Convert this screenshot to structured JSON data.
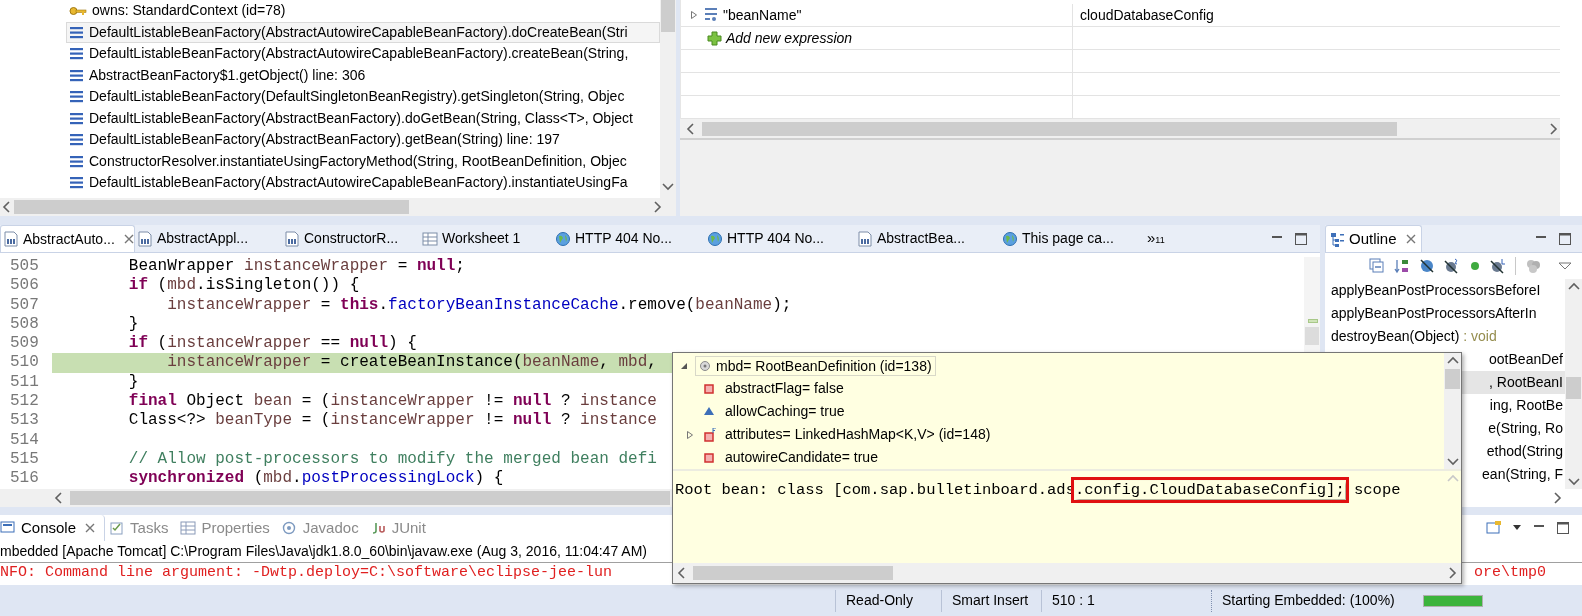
{
  "debug_stack": {
    "frames": [
      {
        "kind": "owner",
        "label": "owns: StandardContext  (id=78)",
        "selected": false
      },
      {
        "kind": "frame",
        "label": "DefaultListableBeanFactory(AbstractAutowireCapableBeanFactory).doCreateBean(Stri",
        "selected": true
      },
      {
        "kind": "frame",
        "label": "DefaultListableBeanFactory(AbstractAutowireCapableBeanFactory).createBean(String,",
        "selected": false
      },
      {
        "kind": "frame",
        "label": "AbstractBeanFactory$1.getObject() line: 306",
        "selected": false
      },
      {
        "kind": "frame",
        "label": "DefaultListableBeanFactory(DefaultSingletonBeanRegistry).getSingleton(String, Objec",
        "selected": false
      },
      {
        "kind": "frame",
        "label": "DefaultListableBeanFactory(AbstractBeanFactory).doGetBean(String, Class<T>, Object",
        "selected": false
      },
      {
        "kind": "frame",
        "label": "DefaultListableBeanFactory(AbstractBeanFactory).getBean(String) line: 197",
        "selected": false
      },
      {
        "kind": "frame",
        "label": "ConstructorResolver.instantiateUsingFactoryMethod(String, RootBeanDefinition, Objec",
        "selected": false
      },
      {
        "kind": "frame",
        "label": "DefaultListableBeanFactory(AbstractAutowireCapableBeanFactory).instantiateUsingFa",
        "selected": false
      }
    ]
  },
  "expressions": {
    "rows": [
      {
        "kind": "expression",
        "name": "\"beanName\"",
        "value": "cloudDatabaseConfig",
        "expanded": false
      },
      {
        "kind": "add",
        "name": "Add new expression"
      }
    ]
  },
  "editor": {
    "tabs": [
      {
        "label": "AbstractAuto...",
        "kind": "class",
        "selected": true
      },
      {
        "label": "AbstractAppl...",
        "kind": "class",
        "selected": false
      },
      {
        "label": "ConstructorR...",
        "kind": "class",
        "selected": false
      },
      {
        "label": "Worksheet 1",
        "kind": "sql",
        "selected": false
      },
      {
        "label": "HTTP 404 No...",
        "kind": "web",
        "selected": false
      },
      {
        "label": "HTTP 404 No...",
        "kind": "web",
        "selected": false
      },
      {
        "label": "AbstractBea...",
        "kind": "class",
        "selected": false
      },
      {
        "label": "This page ca...",
        "kind": "web",
        "selected": false
      }
    ],
    "overflow": "»",
    "overflow_count": "11",
    "lines": [
      {
        "number": "505",
        "highlighted": false,
        "tokens": [
          {
            "kind": "plain",
            "text": "        BeanWrapper "
          },
          {
            "kind": "local",
            "text": "instanceWrapper"
          },
          {
            "kind": "plain",
            "text": " = "
          },
          {
            "kind": "keyword",
            "text": "null"
          },
          {
            "kind": "plain",
            "text": ";"
          }
        ]
      },
      {
        "number": "506",
        "highlighted": false,
        "tokens": [
          {
            "kind": "keyword",
            "text": "        if"
          },
          {
            "kind": "plain",
            "text": " ("
          },
          {
            "kind": "local",
            "text": "mbd"
          },
          {
            "kind": "plain",
            "text": ".isSingleton()) {"
          }
        ]
      },
      {
        "number": "507",
        "highlighted": false,
        "tokens": [
          {
            "kind": "local",
            "text": "            instanceWrapper"
          },
          {
            "kind": "plain",
            "text": " = "
          },
          {
            "kind": "keyword",
            "text": "this"
          },
          {
            "kind": "plain",
            "text": "."
          },
          {
            "kind": "field",
            "text": "factoryBeanInstanceCache"
          },
          {
            "kind": "plain",
            "text": ".remove("
          },
          {
            "kind": "local",
            "text": "beanName"
          },
          {
            "kind": "plain",
            "text": ");"
          }
        ]
      },
      {
        "number": "508",
        "highlighted": false,
        "tokens": [
          {
            "kind": "plain",
            "text": "        }"
          }
        ]
      },
      {
        "number": "509",
        "highlighted": false,
        "tokens": [
          {
            "kind": "keyword",
            "text": "        if"
          },
          {
            "kind": "plain",
            "text": " ("
          },
          {
            "kind": "local",
            "text": "instanceWrapper"
          },
          {
            "kind": "plain",
            "text": " == "
          },
          {
            "kind": "keyword",
            "text": "null"
          },
          {
            "kind": "plain",
            "text": ") {"
          }
        ]
      },
      {
        "number": "510",
        "highlighted": true,
        "tokens": [
          {
            "kind": "local",
            "text": "            instanceWrapper"
          },
          {
            "kind": "plain",
            "text": " = createBeanInstance("
          },
          {
            "kind": "local",
            "text": "beanName"
          },
          {
            "kind": "plain",
            "text": ", "
          },
          {
            "kind": "local",
            "text": "mbd"
          },
          {
            "kind": "plain",
            "text": ","
          }
        ]
      },
      {
        "number": "511",
        "highlighted": false,
        "tokens": [
          {
            "kind": "plain",
            "text": "        }"
          }
        ]
      },
      {
        "number": "512",
        "highlighted": false,
        "tokens": [
          {
            "kind": "keyword",
            "text": "        final"
          },
          {
            "kind": "plain",
            "text": " Object "
          },
          {
            "kind": "local",
            "text": "bean"
          },
          {
            "kind": "plain",
            "text": " = ("
          },
          {
            "kind": "local",
            "text": "instanceWrapper"
          },
          {
            "kind": "plain",
            "text": " != "
          },
          {
            "kind": "keyword",
            "text": "null"
          },
          {
            "kind": "plain",
            "text": " ? "
          },
          {
            "kind": "local",
            "text": "instance"
          }
        ]
      },
      {
        "number": "513",
        "highlighted": false,
        "tokens": [
          {
            "kind": "plain",
            "text": "        Class<?> "
          },
          {
            "kind": "local",
            "text": "beanType"
          },
          {
            "kind": "plain",
            "text": " = ("
          },
          {
            "kind": "local",
            "text": "instanceWrapper"
          },
          {
            "kind": "plain",
            "text": " != "
          },
          {
            "kind": "keyword",
            "text": "null"
          },
          {
            "kind": "plain",
            "text": " ? "
          },
          {
            "kind": "local",
            "text": "instance"
          }
        ]
      },
      {
        "number": "514",
        "highlighted": false
      },
      {
        "number": "515",
        "highlighted": false,
        "tokens": [
          {
            "kind": "comment",
            "text": "        // Allow post-processors to modify the merged bean defi"
          }
        ]
      },
      {
        "number": "516",
        "highlighted": false,
        "tokens": [
          {
            "kind": "keyword",
            "text": "        synchronized"
          },
          {
            "kind": "plain",
            "text": " ("
          },
          {
            "kind": "local",
            "text": "mbd"
          },
          {
            "kind": "plain",
            "text": "."
          },
          {
            "kind": "field",
            "text": "postProcessingLock"
          },
          {
            "kind": "plain",
            "text": ") {"
          }
        ]
      }
    ]
  },
  "outline": {
    "title": "Outline",
    "items": [
      {
        "kind": "full",
        "label": "applyBeanPostProcessorsBeforeI",
        "selected": false
      },
      {
        "kind": "full",
        "label": "applyBeanPostProcessorsAfterIn",
        "selected": false
      },
      {
        "kind": "full",
        "label": "destroyBean(Object)",
        "type": " : void",
        "selected": false
      },
      {
        "kind": "cut",
        "label": "ootBeanDef",
        "selected": false
      },
      {
        "kind": "cut",
        "label": ", RootBeanI",
        "selected": true
      },
      {
        "kind": "cut",
        "label": "ing, RootBe",
        "selected": false
      },
      {
        "kind": "cut",
        "label": "e(String, Ro",
        "selected": false
      },
      {
        "kind": "cut",
        "label": "ethod(String",
        "selected": false
      },
      {
        "kind": "cut",
        "label": "ean(String, F",
        "selected": false
      }
    ]
  },
  "hover": {
    "root": {
      "label": "mbd= RootBeanDefinition  (id=138)",
      "expanded": true,
      "children": [
        {
          "kind": "private",
          "label": "abstractFlag= false",
          "expandable": false
        },
        {
          "kind": "default",
          "label": "allowCaching= true",
          "expandable": false
        },
        {
          "kind": "private_final",
          "label": "attributes= LinkedHashMap<K,V>  (id=148)",
          "expandable": true
        },
        {
          "kind": "private",
          "label": "autowireCandidate= true",
          "expandable": false
        }
      ]
    },
    "detail": {
      "before": "Root bean: class [com.sap.bulletinboard.ads",
      "highlighted": ".config.CloudDatabaseConfig];",
      "after": " scope"
    }
  },
  "console": {
    "tabs": [
      {
        "label": "Console",
        "kind": "console",
        "selected": true
      },
      {
        "label": "Tasks",
        "kind": "tasks",
        "selected": false
      },
      {
        "label": "Properties",
        "kind": "properties",
        "selected": false
      },
      {
        "label": "Javadoc",
        "kind": "javadoc",
        "selected": false
      },
      {
        "label": "JUnit",
        "kind": "junit",
        "selected": false
      }
    ],
    "process": "mbedded [Apache Tomcat] C:\\Program Files\\Java\\jdk1.8.0_60\\bin\\javaw.exe (Aug 3, 2016, 11:04:47 AM)",
    "output": [
      {
        "kind": "error",
        "text": "NFO: Command line argument: -Dwtp.deploy=C:\\software\\eclipse-jee-lun",
        "text_right": "ore\\tmp0"
      }
    ]
  },
  "status_bar": {
    "items": [
      "Read-Only",
      "Smart Insert",
      "510 : 1"
    ],
    "progress": {
      "label": "Starting Embedded: (100%)",
      "level": 1
    }
  }
}
